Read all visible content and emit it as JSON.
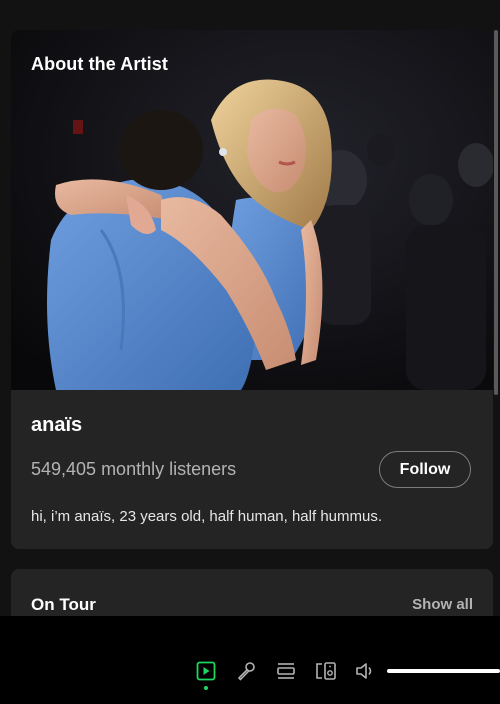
{
  "about": {
    "title": "About the Artist",
    "artist_name": "anaïs",
    "monthly_listeners": "549,405 monthly listeners",
    "follow_label": "Follow",
    "bio": "hi, i’m anaïs, 23 years old, half human, half hummus."
  },
  "on_tour": {
    "title": "On Tour",
    "show_all_label": "Show all"
  },
  "player": {
    "controls": [
      {
        "icon": "now-playing-view-icon",
        "active": true
      },
      {
        "icon": "lyrics-microphone-icon",
        "active": false
      },
      {
        "icon": "queue-icon",
        "active": false
      },
      {
        "icon": "connect-device-icon",
        "active": false
      },
      {
        "icon": "volume-icon",
        "active": false
      }
    ],
    "volume_level": 1.0
  },
  "colors": {
    "accent": "#1ed760",
    "background": "#121212",
    "card": "#242424",
    "text_secondary": "#b3b3b3"
  }
}
